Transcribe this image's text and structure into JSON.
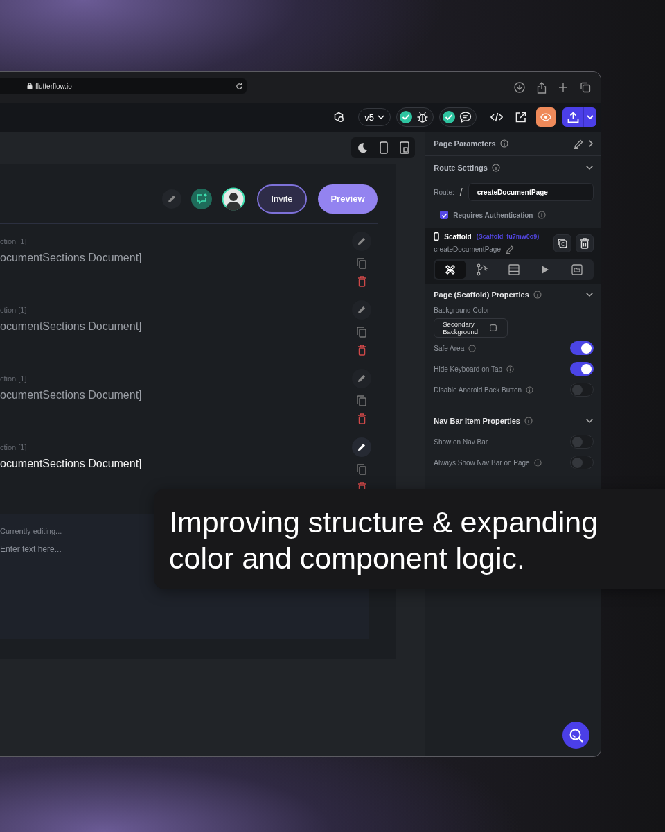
{
  "browser": {
    "url": "flutterflow.io"
  },
  "toolbar": {
    "version": "v5",
    "checks": [
      {
        "kind": "debug",
        "passed": true
      },
      {
        "kind": "chat",
        "passed": true
      }
    ]
  },
  "header": {
    "invite": "Invite",
    "preview": "Preview"
  },
  "sections": [
    {
      "label": "ction [1]",
      "title": "ocumentSections Document]",
      "selected": false
    },
    {
      "label": "ction [1]",
      "title": "ocumentSections Document]",
      "selected": false
    },
    {
      "label": "ction [1]",
      "title": "ocumentSections Document]",
      "selected": false
    },
    {
      "label": "ction [1]",
      "title": "ocumentSections Document]",
      "selected": true
    }
  ],
  "editor": {
    "status": "Currently editing...",
    "placeholder": "Enter text here..."
  },
  "panel": {
    "title": "Page Parameters",
    "route_settings": {
      "title": "Route Settings",
      "label": "Route:",
      "slash": "/",
      "route": "createDocumentPage",
      "auth_label": "Requires Authentication",
      "auth_checked": true
    },
    "widget": {
      "type": "Scaffold",
      "id": "(Scaffold_fu7mw0o9)",
      "name": "createDocumentPage",
      "tabs": [
        {
          "kind": "properties",
          "selected": true
        },
        {
          "kind": "logic",
          "selected": false
        },
        {
          "kind": "backend",
          "selected": false
        },
        {
          "kind": "actions",
          "selected": false
        },
        {
          "kind": "file",
          "selected": false
        }
      ]
    },
    "properties": {
      "title": "Page (Scaffold) Properties",
      "bg_label": "Background Color",
      "bg_value": "Secondary Background",
      "toggles": [
        {
          "label": "Safe Area",
          "info": true,
          "on": true
        },
        {
          "label": "Hide Keyboard on Tap",
          "info": true,
          "on": true
        },
        {
          "label": "Disable Android Back Button",
          "info": true,
          "on": false
        }
      ]
    },
    "nav_bar": {
      "title": "Nav Bar Item Properties",
      "toggles": [
        {
          "label": "Show on Nav Bar",
          "info": false,
          "on": false
        },
        {
          "label": "Always Show Nav Bar on Page",
          "info": true,
          "on": false
        }
      ]
    }
  },
  "caption": "Improving structure & expanding color and component logic."
}
